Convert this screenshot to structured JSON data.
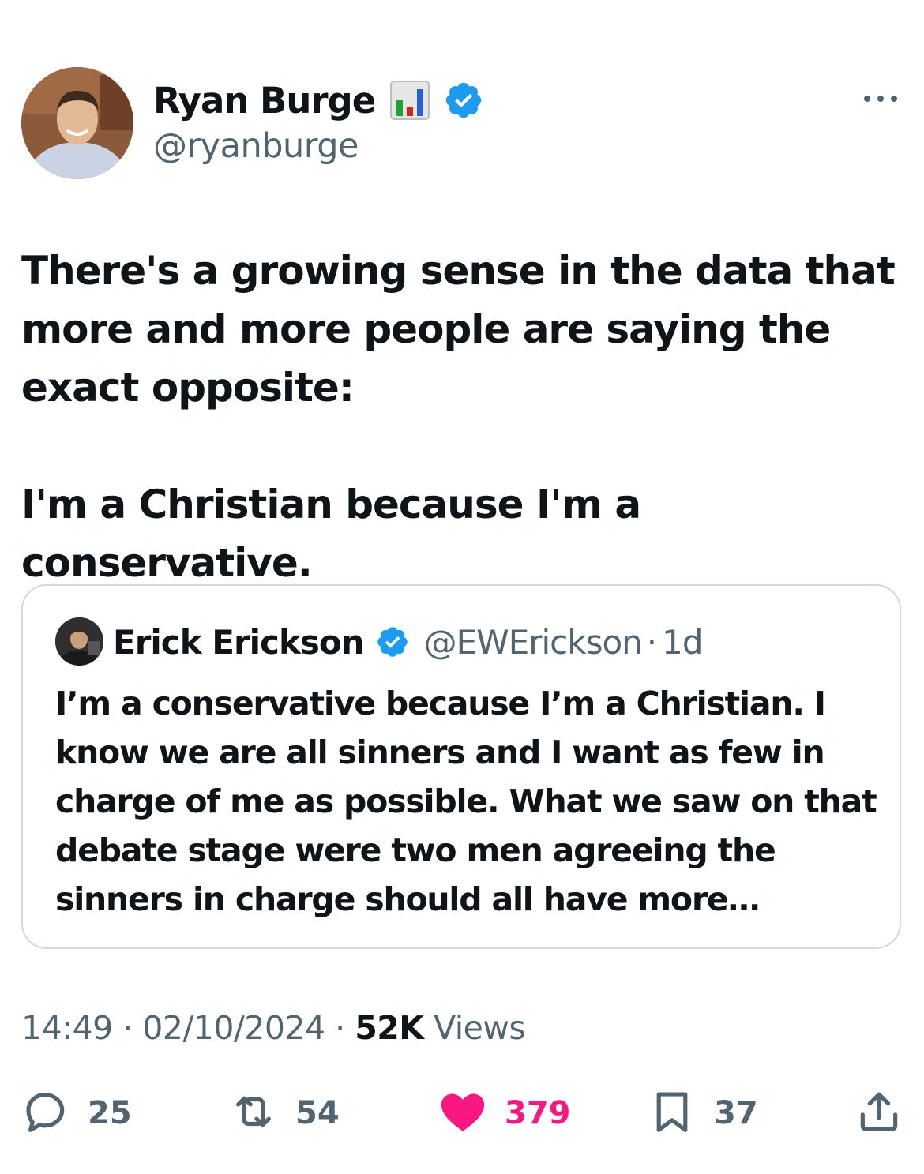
{
  "tweet": {
    "author": {
      "name": "Ryan Burge",
      "handle": "@ryanburge",
      "name_emoji_icon": "bar-chart-emoji-icon",
      "verified": true
    },
    "text": "There's a growing sense in the data that more and more people are saying the exact opposite:\n\nI'm a Christian because I'm a conservative.",
    "quoted": {
      "author_name": "Erick Erickson",
      "handle": "@EWErickson",
      "separator": "·",
      "time": "1d",
      "verified": true,
      "text": "I’m a conservative because I’m a Christian.  I know we are all sinners and I want as few in charge of me as possible.  What we saw on that debate stage were two men agreeing the sinners in charge should all have more…"
    },
    "meta": {
      "time": "14:49",
      "sep1": "·",
      "date": "02/10/2024",
      "sep2": "·",
      "views_count": "52K",
      "views_label": "Views"
    },
    "actions": {
      "replies": "25",
      "reposts": "54",
      "likes": "379",
      "bookmarks": "37"
    }
  },
  "colors": {
    "text": "#0f1419",
    "secondary": "#536471",
    "verified": "#1d9bf0",
    "like": "#f91880",
    "border": "#cfd9de"
  }
}
